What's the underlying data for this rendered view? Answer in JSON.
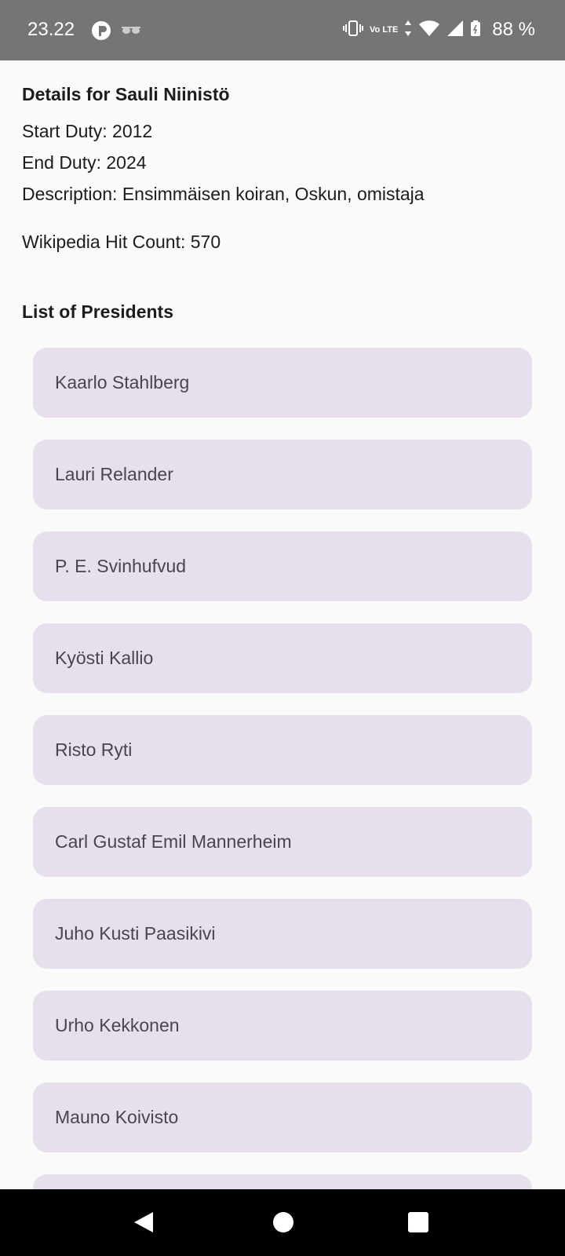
{
  "status_bar": {
    "time": "23.22",
    "network_label": "Vo LTE",
    "battery_percent": "88 %",
    "icons": [
      "app-notification-icon",
      "glasses-icon",
      "vibrate-icon",
      "volte-icon",
      "data-arrows-icon",
      "wifi-icon",
      "signal-icon",
      "battery-icon"
    ]
  },
  "details": {
    "title": "Details for Sauli Niinistö",
    "start_duty": "Start Duty: 2012",
    "end_duty": "End Duty: 2024",
    "description": "Description: Ensimmäisen koiran, Oskun, omistaja",
    "wiki_hits": "Wikipedia Hit Count: 570"
  },
  "list": {
    "title": "List of Presidents",
    "items": [
      "Kaarlo Stahlberg",
      "Lauri Relander",
      "P. E. Svinhufvud",
      "Kyösti Kallio",
      "Risto Ryti",
      "Carl Gustaf Emil Mannerheim",
      "Juho Kusti Paasikivi",
      "Urho Kekkonen",
      "Mauno Koivisto",
      ""
    ]
  },
  "colors": {
    "status_bar": "#757575",
    "background": "#fafafa",
    "list_item_bg": "#e7dfeb",
    "list_item_text": "#49454f",
    "nav_bar": "#000000"
  },
  "nav_bar": {
    "icons": [
      "back-icon",
      "home-icon",
      "recents-icon"
    ]
  }
}
